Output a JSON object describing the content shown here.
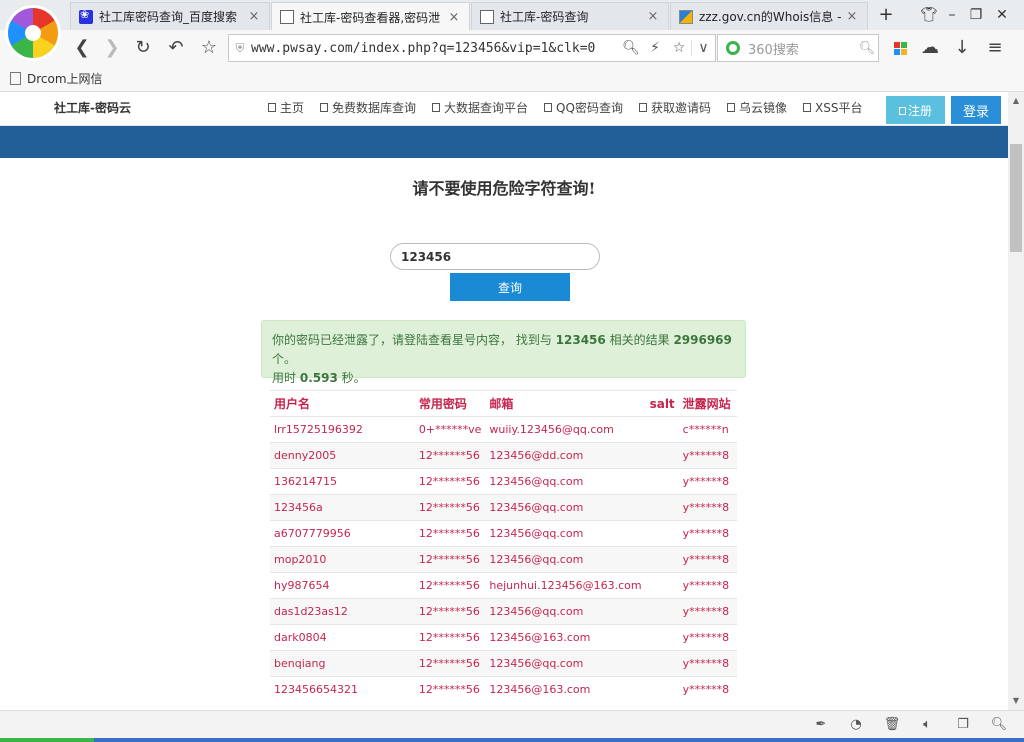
{
  "tabs": [
    {
      "title": "社工库密码查询_百度搜索",
      "favicon": "baidu-paw-icon",
      "active": false
    },
    {
      "title": "社工库-密码查看器,密码泄",
      "favicon": "document-icon",
      "active": true
    },
    {
      "title": "社工库-密码查询",
      "favicon": "document-icon",
      "active": false
    },
    {
      "title": "zzz.gov.cn的Whois信息 -",
      "favicon": "whois-icon",
      "active": false
    }
  ],
  "tab_close_glyph": "×",
  "new_tab_glyph": "+",
  "address_bar": {
    "url": "www.pwsay.com/index.php?q=123456&vip=1&clk=0"
  },
  "search_bar": {
    "placeholder": "360搜索"
  },
  "bookmarks": [
    {
      "label": "Drcom上网信"
    }
  ],
  "site": {
    "brand": "社工库-密码云",
    "nav": [
      "主页",
      "免费数据库查询",
      "大数据查询平台",
      "QQ密码查询",
      "获取邀请码",
      "乌云镜像",
      "XSS平台"
    ],
    "register_label": "注册",
    "login_label": "登录"
  },
  "warning": "请不要使用危险字符查询!",
  "search": {
    "value": "123456",
    "button": "查询"
  },
  "alert": {
    "prefix": "你的密码已经泄露了，请登陆查看星号内容， 找到与",
    "query": "123456",
    "middle": "相关的结果",
    "count": "2996969",
    "suffix": "个。",
    "time_prefix": "用时",
    "time": "0.593",
    "time_suffix": "秒。"
  },
  "table": {
    "headers": [
      "用户名",
      "常用密码",
      "邮箱",
      "salt",
      "泄露网站"
    ],
    "rows": [
      [
        "lrr15725196392",
        "0+******ve",
        "wuiiy.123456@qq.com",
        "",
        "c******n"
      ],
      [
        "denny2005",
        "12******56",
        "123456@dd.com",
        "",
        "y******8"
      ],
      [
        "136214715",
        "12******56",
        "123456@qq.com",
        "",
        "y******8"
      ],
      [
        "123456a",
        "12******56",
        "123456@qq.com",
        "",
        "y******8"
      ],
      [
        "a6707779956",
        "12******56",
        "123456@qq.com",
        "",
        "y******8"
      ],
      [
        "mop2010",
        "12******56",
        "123456@qq.com",
        "",
        "y******8"
      ],
      [
        "hy987654",
        "12******56",
        "hejunhui.123456@163.com",
        "",
        "y******8"
      ],
      [
        "das1d23as12",
        "12******56",
        "123456@qq.com",
        "",
        "y******8"
      ],
      [
        "dark0804",
        "12******56",
        "123456@163.com",
        "",
        "y******8"
      ],
      [
        "benqiang",
        "12******56",
        "123456@qq.com",
        "",
        "y******8"
      ],
      [
        "123456654321",
        "12******56",
        "123456@163.com",
        "",
        "y******8"
      ]
    ]
  },
  "colors": {
    "nav_band": "#225e97",
    "query_button": "#1a8ad4",
    "register": "#5bc0de",
    "login": "#2a8fd6",
    "table_text": "#c7254e",
    "alert_bg": "#dff0d8"
  }
}
